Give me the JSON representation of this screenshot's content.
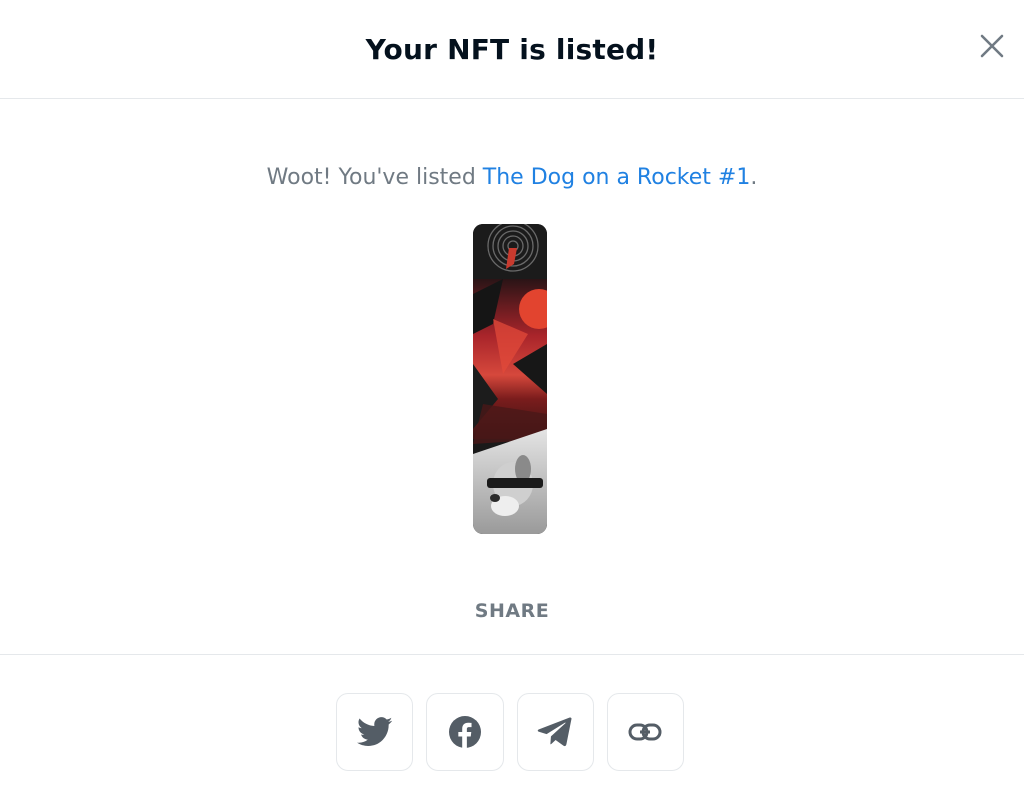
{
  "modal": {
    "title": "Your NFT is listed!",
    "close_icon": "close-icon"
  },
  "message": {
    "prefix": "Woot! You've listed ",
    "nft_name": "The Dog on a Rocket #1",
    "suffix": "."
  },
  "nft_image": {
    "subject": "The Dog on a Rocket #1 artwork"
  },
  "share": {
    "label": "SHARE",
    "buttons": [
      {
        "name": "twitter",
        "icon": "twitter-icon"
      },
      {
        "name": "facebook",
        "icon": "facebook-icon"
      },
      {
        "name": "telegram",
        "icon": "telegram-icon"
      },
      {
        "name": "copy-link",
        "icon": "link-icon"
      }
    ]
  },
  "colors": {
    "link": "#2081e2",
    "muted_text": "#707a83",
    "icon": "#545d66",
    "border": "#e5e8eb"
  }
}
